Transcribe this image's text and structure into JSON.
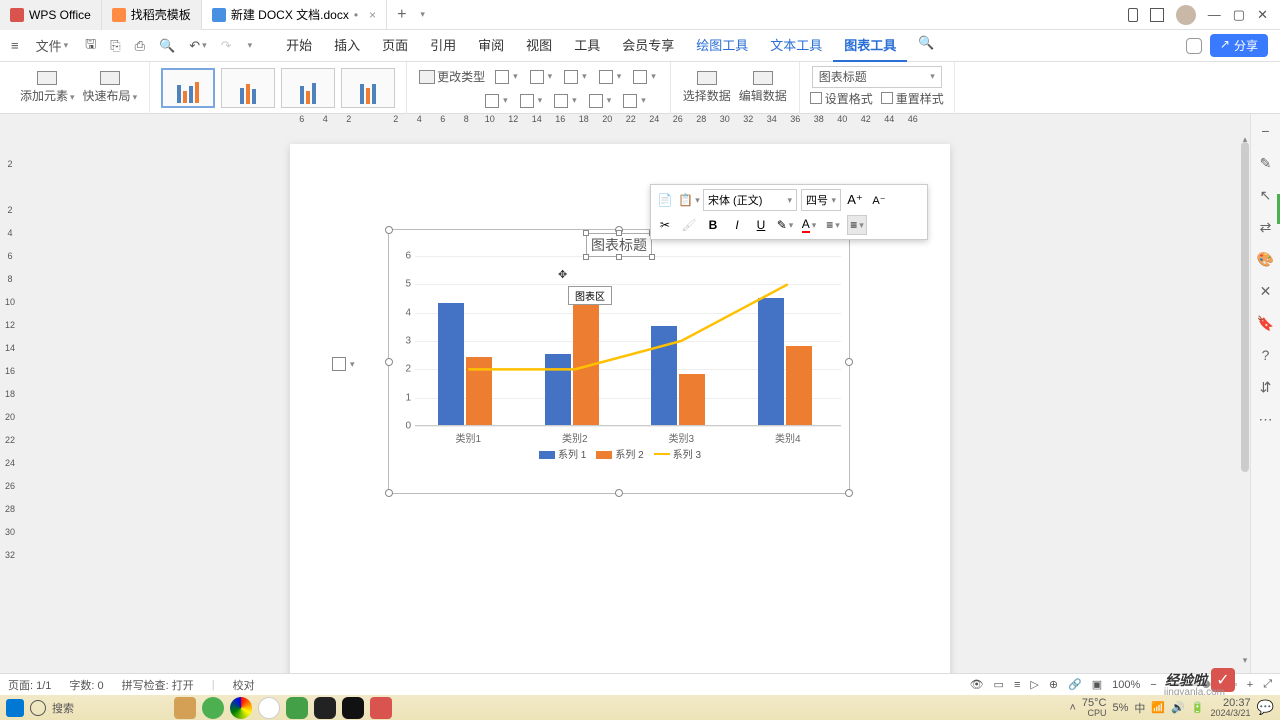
{
  "titlebar": {
    "app_tab": "WPS Office",
    "template_tab": "找稻壳模板",
    "doc_tab": "新建 DOCX 文档.docx",
    "doc_modified": "•"
  },
  "menubar": {
    "file": "文件",
    "items": [
      "开始",
      "插入",
      "页面",
      "引用",
      "审阅",
      "视图",
      "工具",
      "会员专享",
      "绘图工具",
      "文本工具",
      "图表工具"
    ],
    "share": "分享"
  },
  "ribbon": {
    "add_element": "添加元素",
    "quick_layout": "快速布局",
    "change_type": "更改类型",
    "select_data": "选择数据",
    "edit_data": "编辑数据",
    "set_format": "设置格式",
    "reset_style": "重置样式",
    "element_dd": "图表标题"
  },
  "hruler": [
    "6",
    "4",
    "2",
    "",
    "2",
    "4",
    "6",
    "8",
    "10",
    "12",
    "14",
    "16",
    "18",
    "20",
    "22",
    "24",
    "26",
    "28",
    "30",
    "32",
    "34",
    "36",
    "38",
    "40",
    "42",
    "44",
    "46"
  ],
  "vruler": [
    "",
    "2",
    "",
    "2",
    "4",
    "6",
    "8",
    "10",
    "12",
    "14",
    "16",
    "18",
    "20",
    "22",
    "24",
    "26",
    "28",
    "30",
    "32"
  ],
  "mini_toolbar": {
    "font": "宋体 (正文)",
    "size": "四号",
    "bold": "B",
    "italic": "I",
    "underline": "U"
  },
  "chart_title_text": "图表标题",
  "tooltip": "图表区",
  "chart_data": {
    "type": "bar",
    "title": "图表标题",
    "categories": [
      "类别1",
      "类别2",
      "类别3",
      "类别4"
    ],
    "series": [
      {
        "name": "系列 1",
        "type": "bar",
        "values": [
          4.3,
          2.5,
          3.5,
          4.5
        ]
      },
      {
        "name": "系列 2",
        "type": "bar",
        "values": [
          2.4,
          4.4,
          1.8,
          2.8
        ]
      },
      {
        "name": "系列 3",
        "type": "line",
        "values": [
          2.0,
          2.0,
          3.0,
          5.0
        ]
      }
    ],
    "ylim": [
      0,
      6
    ],
    "yticks": [
      0,
      1,
      2,
      3,
      4,
      5,
      6
    ],
    "xlabel": "",
    "ylabel": ""
  },
  "status": {
    "page": "页面: 1/1",
    "words": "字数: 0",
    "spell": "拼写检查: 打开",
    "proof": "校对",
    "zoom": "100%"
  },
  "taskbar": {
    "search_placeholder": "搜索",
    "temp": "75°C",
    "cpu": "CPU",
    "cpu_pct": "5%",
    "time": "20:37",
    "date": "2024/3/21"
  },
  "watermark": {
    "text": "经验啦",
    "sub": "jingyanla.com"
  }
}
